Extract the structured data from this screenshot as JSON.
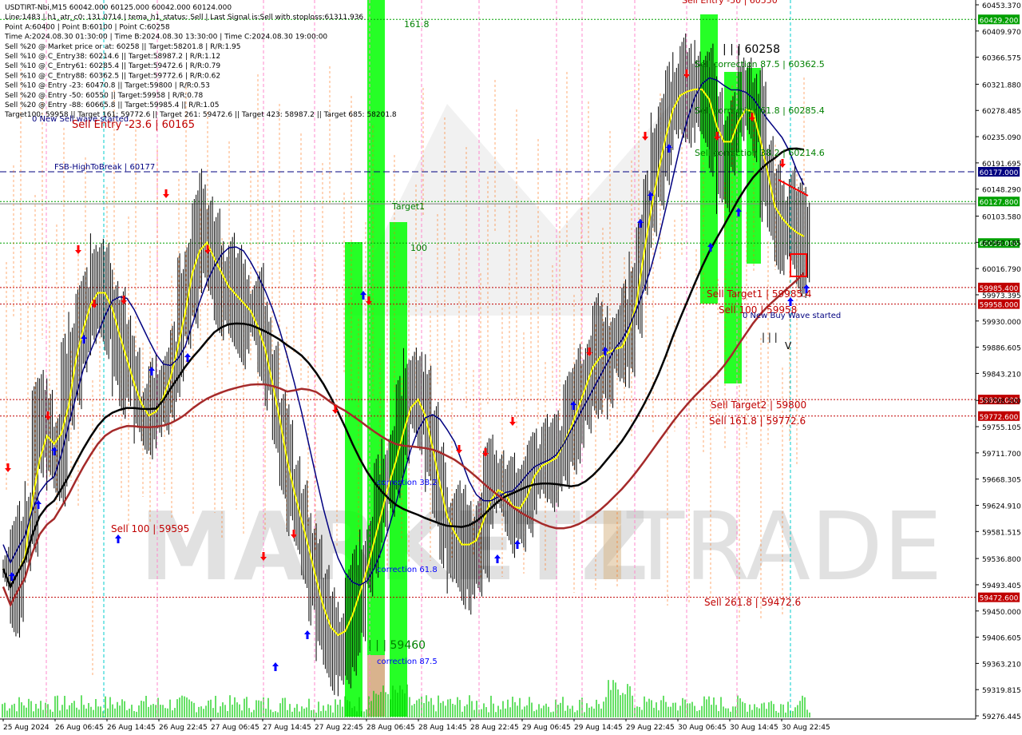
{
  "colors": {
    "background": "#ffffff",
    "candle": "#000000",
    "ma_yellow": "#ffff00",
    "ma_navy": "#000080",
    "ma_black": "#000000",
    "ma_darkred": "#a52a2a",
    "zone_green": "#00ff00",
    "zone_tan": "#d2a679",
    "level_red": "#c00000",
    "level_green": "#008000",
    "level_blue": "#000080",
    "label_red_bg": "#c00000",
    "label_green_bg": "#00a000",
    "label_blue_bg": "#000080",
    "arrow_up": "#0000ff",
    "arrow_down": "#ff0000",
    "volume": "#00cc00",
    "watermark": "#c8c8c8"
  },
  "info_lines": [
    "USDTIRT-Nbi,M15  60042.000 60125.000 60042.000 60124.000",
    "Line:1483 | h1_atr_c0: 131.0714 | tema_h1_status: Sell | Last Signal is:Sell with stoploss:61311.936",
    "Point A:60400 | Point B:60100 | Point C:60258",
    "Time A:2024.08.30 01:30:00 | Time B:2024.08.30 13:30:00 | Time C:2024.08.30 19:00:00",
    "Sell %20 @ Market price or at: 60258 || Target:58201.8 | R/R:1.95",
    "Sell %10 @ C_Entry38: 60214.6 || Target:58987.2 | R/R:1.12",
    "Sell %10 @ C_Entry61: 60285.4 || Target:59472.6 | R/R:0.79",
    "Sell %10 @ C_Entry88: 60362.5 || Target:59772.6 | R/R:0.62",
    "Sell %10 @ Entry -23: 60470.8 || Target:59800 | R/R:0.53",
    "Sell %20 @ Entry -50: 60550 || Target:59958 | R/R:0.78",
    "Sell %20 @ Entry -88: 60665.8 || Target:59985.4 || R/R:1.05",
    "Target100: 59958 || Target 161: 59772.6 || Target 261: 59472.6 || Target 423: 58987.2 || Target 685: 58201.8"
  ],
  "chart_labels": [
    {
      "text": "0 New Sell wave started",
      "color": "#000080"
    },
    {
      "text": "Sell Entry -23.6 | 60165",
      "color": "#c00000"
    },
    {
      "text": "FSB-HighToBreak | 60177",
      "color": "#000080"
    },
    {
      "text": "161.8",
      "color": "#008000"
    },
    {
      "text": "Target1",
      "color": "#008000"
    },
    {
      "text": "100",
      "color": "#008000"
    },
    {
      "text": "Sell 100 | 59595",
      "color": "#c00000"
    },
    {
      "text": "correction 38.2",
      "color": "#0000ff"
    },
    {
      "text": "correction 61.8",
      "color": "#0000ff"
    },
    {
      "text": "correction 87.5",
      "color": "#0000ff"
    },
    {
      "text": "| | | 59460",
      "color": "#008000"
    },
    {
      "text": "| | | 60258",
      "color": "#000000"
    },
    {
      "text": "Sell correction 87.5 | 60362.5",
      "color": "#008000"
    },
    {
      "text": "Sell correction 61.8 | 60285.4",
      "color": "#008000"
    },
    {
      "text": "Sell correction 38.2 | 60214.6",
      "color": "#008000"
    },
    {
      "text": "Sell Target1 | 59985.4",
      "color": "#c00000"
    },
    {
      "text": "Sell 100 | 59958",
      "color": "#c00000"
    },
    {
      "text": "0 New Buy Wave started",
      "color": "#000080"
    },
    {
      "text": "Sell Target2 | 59800",
      "color": "#c00000"
    },
    {
      "text": "Sell 161.8 | 59772.6",
      "color": "#c00000"
    },
    {
      "text": "Sell 261.8 | 59472.6",
      "color": "#c00000"
    },
    {
      "text": "Sell Entry -50 | 60550",
      "color": "#c00000"
    },
    {
      "text": "| | |",
      "color": "#000000"
    },
    {
      "text": "V",
      "color": "#000000"
    }
  ],
  "watermark": {
    "part1": "MARKETZ",
    "part2": "I",
    "part3": "TRADE"
  },
  "chart_data": {
    "type": "candlestick",
    "symbol": "USDTIRT-Nbi",
    "timeframe": "M15",
    "ylim": [
      59276.445,
      60453.37
    ],
    "y_ticks": [
      60453.37,
      60409.97,
      60366.575,
      60321.88,
      60278.485,
      60235.09,
      60191.695,
      60148.29,
      60103.58,
      60060.185,
      60016.79,
      59973.395,
      59930.0,
      59886.605,
      59843.21,
      59798.5,
      59755.105,
      59711.7,
      59668.305,
      59624.91,
      59581.515,
      59536.8,
      59493.405,
      59450.0,
      59406.605,
      59363.21,
      59319.815,
      59276.445
    ],
    "x_ticks": [
      "25 Aug 2024",
      "26 Aug 06:45",
      "26 Aug 14:45",
      "26 Aug 22:45",
      "27 Aug 06:45",
      "27 Aug 14:45",
      "27 Aug 22:45",
      "28 Aug 06:45",
      "28 Aug 14:45",
      "28 Aug 22:45",
      "29 Aug 06:45",
      "29 Aug 14:45",
      "29 Aug 22:45",
      "30 Aug 06:45",
      "30 Aug 14:45",
      "30 Aug 22:45"
    ],
    "price_levels": [
      {
        "value": 60429.2,
        "label": "60429.200",
        "color": "#00a000",
        "style": "dotted"
      },
      {
        "value": 60177.0,
        "label": "60177.000",
        "color": "#000080",
        "style": "dashed"
      },
      {
        "value": 60127.8,
        "label": "60127.800",
        "color": "#00a000",
        "style": "dotted"
      },
      {
        "value": 60124.0,
        "label": "",
        "color": "#808080",
        "style": "solid"
      },
      {
        "value": 60059.0,
        "label": "60059.000",
        "color": "#00a000",
        "style": "dotted"
      },
      {
        "value": 59985.4,
        "label": "59985.400",
        "color": "#c00000",
        "style": "dotted"
      },
      {
        "value": 59958.0,
        "label": "59958.000",
        "color": "#c00000",
        "style": "dotted"
      },
      {
        "value": 59800.0,
        "label": "59800.000",
        "color": "#c00000",
        "style": "dotted"
      },
      {
        "value": 59772.6,
        "label": "59772.600",
        "color": "#c00000",
        "style": "dotted"
      },
      {
        "value": 59472.6,
        "label": "59472.600",
        "color": "#c00000",
        "style": "dotted"
      }
    ],
    "closes": [
      59520,
      59460,
      59560,
      59600,
      59740,
      59760,
      59720,
      59700,
      59810,
      59860,
      59930,
      59960,
      59980,
      59990,
      59960,
      59900,
      59860,
      59840,
      59780,
      59760,
      59780,
      59800,
      59830,
      59880,
      59950,
      60000,
      60080,
      60060,
      60040,
      60000,
      59990,
      59970,
      59960,
      59950,
      59930,
      59880,
      59840,
      59760,
      59700,
      59640,
      59600,
      59560,
      59500,
      59450,
      59420,
      59400,
      59410,
      59440,
      59480,
      59520,
      59560,
      59620,
      59660,
      59700,
      59740,
      59800,
      59820,
      59780,
      59720,
      59660,
      59600,
      59560,
      59580,
      59540,
      59560,
      59600,
      59640,
      59660,
      59650,
      59620,
      59600,
      59640,
      59680,
      59700,
      59690,
      59700,
      59720,
      59760,
      59780,
      59820,
      59860,
      59880,
      59870,
      59880,
      59900,
      59880,
      59960,
      60040,
      60120,
      60180,
      60230,
      60290,
      60320,
      60300,
      60310,
      60330,
      60300,
      60260,
      60200,
      60220,
      60260,
      60300,
      60280,
      60250,
      60160,
      60120,
      60080,
      60100,
      60080,
      60050,
      60080
    ]
  }
}
